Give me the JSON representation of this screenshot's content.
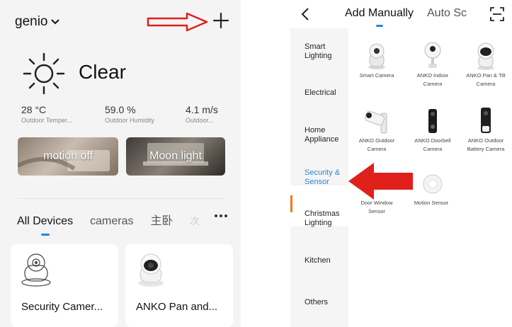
{
  "left": {
    "home_name": "genio",
    "weather": {
      "condition": "Clear",
      "stats": [
        {
          "value": "28 °C",
          "label": "Outdoor Temper..."
        },
        {
          "value": "59.0 %",
          "label": "Outdoor Humidity"
        },
        {
          "value": "4.1 m/s",
          "label": "Outdoor..."
        }
      ]
    },
    "scenes": [
      {
        "label": "motion off"
      },
      {
        "label": "Moon light"
      }
    ],
    "tabs": [
      {
        "label": "All Devices"
      },
      {
        "label": "cameras"
      },
      {
        "label": "主卧"
      },
      {
        "label": "次"
      }
    ],
    "devices": [
      {
        "name": "Security Camer..."
      },
      {
        "name": "ANKO Pan and..."
      }
    ]
  },
  "right": {
    "top_tabs": [
      {
        "label": "Add Manually"
      },
      {
        "label": "Auto Sc"
      }
    ],
    "categories": [
      {
        "line1": "Smart",
        "line2": "Lighting"
      },
      {
        "line1": "Electrical",
        "line2": ""
      },
      {
        "line1": "Home",
        "line2": "Appliance"
      },
      {
        "line1": "Security &",
        "line2": "Sensor"
      },
      {
        "line1": "Christmas",
        "line2": "Lighting"
      },
      {
        "line1": "Kitchen",
        "line2": ""
      },
      {
        "line1": "Others",
        "line2": ""
      }
    ],
    "products": [
      {
        "line1": "Smart Camera",
        "line2": ""
      },
      {
        "line1": "ANKO Indoor",
        "line2": "Camera"
      },
      {
        "line1": "ANKO Pan & Tilt",
        "line2": "Camera"
      },
      {
        "line1": "ANKO Outdoor",
        "line2": "Camera"
      },
      {
        "line1": "ANKO Doorbell",
        "line2": "Camera"
      },
      {
        "line1": "ANKO Outdoor",
        "line2": "Battery Camera"
      },
      {
        "line1": "Door Window",
        "line2": "Sensor"
      },
      {
        "line1": "Motion Sensor",
        "line2": ""
      }
    ]
  },
  "colors": {
    "accent_blue": "#2a86d8",
    "selected_orange": "#f07a1a",
    "annotation_red": "#e0201b"
  }
}
